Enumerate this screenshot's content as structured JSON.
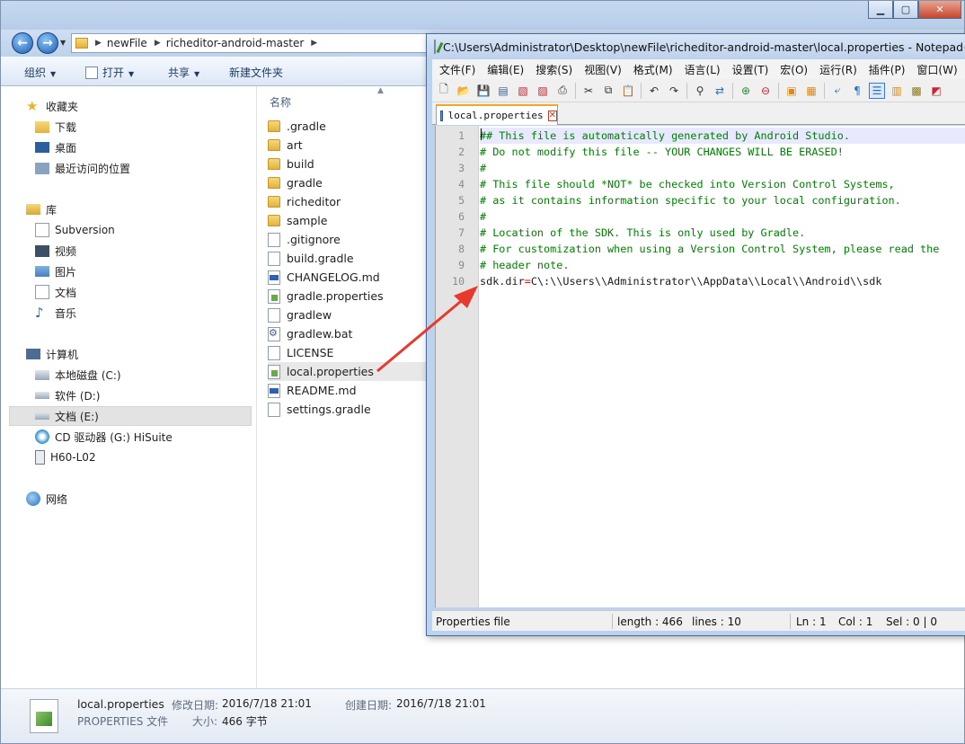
{
  "explorer": {
    "breadcrumb": [
      "newFile",
      "richeditor-android-master"
    ],
    "toolbar": {
      "organize": "组织",
      "open": "打开",
      "share": "共享",
      "new_folder": "新建文件夹"
    },
    "nav": {
      "favorites": "收藏夹",
      "downloads": "下载",
      "desktop": "桌面",
      "recent": "最近访问的位置",
      "libraries": "库",
      "subversion": "Subversion",
      "videos": "视频",
      "pictures": "图片",
      "documents": "文档",
      "music": "音乐",
      "computer": "计算机",
      "drive_c": "本地磁盘 (C:)",
      "drive_d": "软件 (D:)",
      "drive_e": "文档 (E:)",
      "drive_g": "CD 驱动器 (G:) HiSuite",
      "device": "H60-L02",
      "network": "网络"
    },
    "column_name": "名称",
    "files": [
      {
        "name": ".gradle",
        "type": "folder"
      },
      {
        "name": "art",
        "type": "folder"
      },
      {
        "name": "build",
        "type": "folder"
      },
      {
        "name": "gradle",
        "type": "folder"
      },
      {
        "name": "richeditor",
        "type": "folder"
      },
      {
        "name": "sample",
        "type": "folder"
      },
      {
        "name": ".gitignore",
        "type": "doc"
      },
      {
        "name": "build.gradle",
        "type": "doc"
      },
      {
        "name": "CHANGELOG.md",
        "type": "md"
      },
      {
        "name": "gradle.properties",
        "type": "prop"
      },
      {
        "name": "gradlew",
        "type": "doc"
      },
      {
        "name": "gradlew.bat",
        "type": "bat"
      },
      {
        "name": "LICENSE",
        "type": "doc"
      },
      {
        "name": "local.properties",
        "type": "prop"
      },
      {
        "name": "README.md",
        "type": "md"
      },
      {
        "name": "settings.gradle",
        "type": "doc"
      }
    ],
    "details": {
      "filename": "local.properties",
      "filetype": "PROPERTIES 文件",
      "modified_label": "修改日期:",
      "modified_value": "2016/7/18 21:01",
      "created_label": "创建日期:",
      "created_value": "2016/7/18 21:01",
      "size_label": "大小:",
      "size_value": "466 字节"
    }
  },
  "npp": {
    "title": "C:\\Users\\Administrator\\Desktop\\newFile\\richeditor-android-master\\local.properties - Notepad++",
    "menu": [
      "文件(F)",
      "编辑(E)",
      "搜索(S)",
      "视图(V)",
      "格式(M)",
      "语言(L)",
      "设置(T)",
      "宏(O)",
      "运行(R)",
      "插件(P)",
      "窗口(W)"
    ],
    "tab_label": "local.properties",
    "lines": [
      {
        "n": "1",
        "text": "## This file is automatically generated by Android Studio."
      },
      {
        "n": "2",
        "text": "# Do not modify this file -- YOUR CHANGES WILL BE ERASED!"
      },
      {
        "n": "3",
        "text": "#"
      },
      {
        "n": "4",
        "text": "# This file should *NOT* be checked into Version Control Systems,"
      },
      {
        "n": "5",
        "text": "# as it contains information specific to your local configuration."
      },
      {
        "n": "6",
        "text": "#"
      },
      {
        "n": "7",
        "text": "# Location of the SDK. This is only used by Gradle."
      },
      {
        "n": "8",
        "text": "# For customization when using a Version Control System, please read the"
      },
      {
        "n": "9",
        "text": "# header note."
      },
      {
        "n": "10",
        "key": "sdk.dir",
        "eq": "=",
        "value": "C\\:\\\\Users\\\\Administrator\\\\AppData\\\\Local\\\\Android\\\\sdk"
      }
    ],
    "status": {
      "filetype": "Properties file",
      "length": "length : 466",
      "lines": "lines : 10",
      "ln": "Ln : 1",
      "col": "Col : 1",
      "sel": "Sel : 0 | 0"
    }
  },
  "colors": {
    "comment": "#008000",
    "operator": "#ff0000",
    "arrow": "#e8392e"
  }
}
